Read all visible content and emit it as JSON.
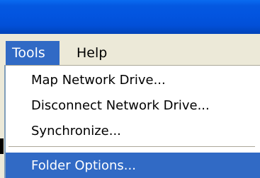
{
  "menubar": {
    "tools_label": "Tools",
    "help_label": "Help"
  },
  "tools_menu": {
    "items": [
      {
        "label": "Map Network Drive..."
      },
      {
        "label": "Disconnect Network Drive..."
      },
      {
        "label": "Synchronize..."
      },
      {
        "label": "Folder Options..."
      }
    ],
    "highlighted_item": "Folder Options..."
  },
  "colors": {
    "titlebar": "#0355e0",
    "menubar_background": "#ece9d8",
    "highlight": "#316ac5",
    "menu_background": "#ffffff",
    "separator": "#aca899"
  }
}
